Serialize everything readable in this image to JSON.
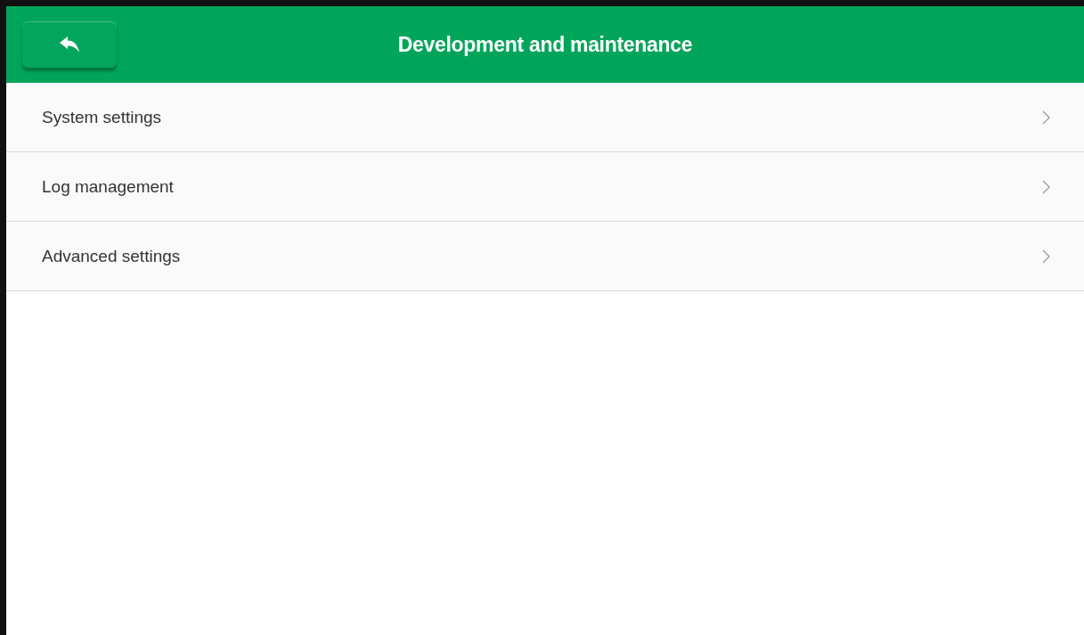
{
  "header": {
    "title": "Development and maintenance"
  },
  "menu": {
    "items": [
      {
        "label": "System settings"
      },
      {
        "label": "Log management"
      },
      {
        "label": "Advanced settings"
      }
    ]
  }
}
